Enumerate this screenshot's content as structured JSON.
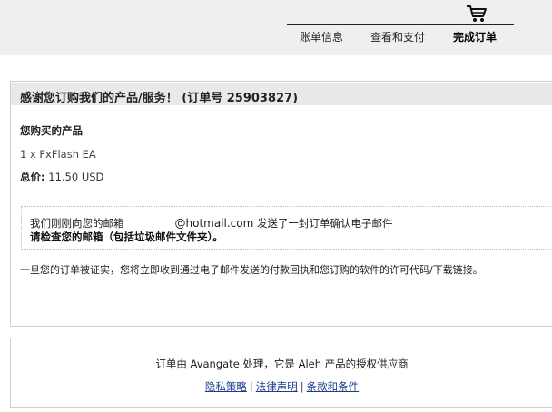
{
  "header": {
    "cart_icon": "shopping-cart-icon",
    "steps": [
      {
        "label": "账单信息"
      },
      {
        "label": "查看和支付"
      },
      {
        "label": "完成订单"
      }
    ]
  },
  "main": {
    "title": "感谢您订购我们的产品/服务！ (订单号 25903827)",
    "purchased_heading": "您购买的产品",
    "product_line": "1 x FxFlash EA",
    "total_label": "总价:",
    "total_value": "11.50 USD",
    "email_notice": {
      "prefix": "我们刚刚向您的邮箱",
      "email_domain": "@hotmail.com",
      "suffix": " 发送了一封订单确认电子邮件",
      "check_inbox": "请检查您的邮箱（包括垃圾邮件文件夹）。"
    },
    "confirmation_notice": "一旦您的订单被证实，您将立即收到通过电子邮件发送的付款回执和您订购的软件的许可代码/下载链接。"
  },
  "footer": {
    "processed_by": "订单由 Avangate 处理，它是 Aleh 产品的授权供应商",
    "links": [
      {
        "label": "隐私策略"
      },
      {
        "label": "法律声明"
      },
      {
        "label": "条款和条件"
      }
    ],
    "separator": "|"
  },
  "colors": {
    "header_bg": "#efefef",
    "title_bar_bg": "#e9e9e9",
    "link": "#1a3d8f"
  }
}
